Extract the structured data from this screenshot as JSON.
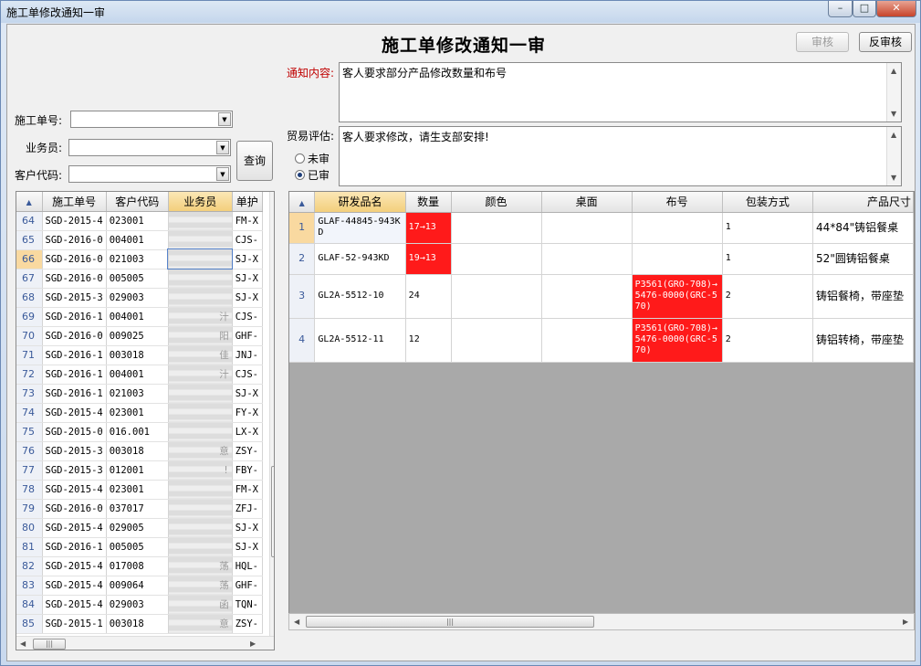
{
  "window": {
    "title": "施工单修改通知一审",
    "minimize": "–",
    "maximize": "□",
    "close": "✕"
  },
  "header": {
    "title": "施工单修改通知一审",
    "approve_label": "审核",
    "unapprove_label": "反审核"
  },
  "filters": {
    "order_no_label": "施工单号:",
    "salesman_label": "业务员:",
    "customer_code_label": "客户代码:",
    "order_no_value": "",
    "salesman_value": "",
    "customer_code_value": "",
    "query_label": "查询"
  },
  "notice": {
    "label": "通知内容:",
    "text": "客人要求部分产品修改数量和布号"
  },
  "trade": {
    "label": "贸易评估:",
    "text": "客人要求修改，请生支部安排!"
  },
  "status": {
    "unreviewed_label": "未审",
    "reviewed_label": "已审",
    "selected": "已审"
  },
  "left_grid": {
    "columns": [
      "施工单号",
      "客户代码",
      "业务员",
      "单护"
    ],
    "selected_row": "66",
    "rows": [
      {
        "n": "64",
        "order": "SGD-2015-4",
        "cust": "023001",
        "sales": "",
        "code": "FM-X"
      },
      {
        "n": "65",
        "order": "SGD-2016-0",
        "cust": "004001",
        "sales": "",
        "code": "CJS-"
      },
      {
        "n": "66",
        "order": "SGD-2016-0",
        "cust": "021003",
        "sales": "",
        "code": "SJ-X"
      },
      {
        "n": "67",
        "order": "SGD-2016-0",
        "cust": "005005",
        "sales": "",
        "code": "SJ-X"
      },
      {
        "n": "68",
        "order": "SGD-2015-3",
        "cust": "029003",
        "sales": "",
        "code": "SJ-X"
      },
      {
        "n": "69",
        "order": "SGD-2016-1",
        "cust": "004001",
        "sales": "汁",
        "code": "CJS-"
      },
      {
        "n": "70",
        "order": "SGD-2016-0",
        "cust": "009025",
        "sales": "阳",
        "code": "GHF-"
      },
      {
        "n": "71",
        "order": "SGD-2016-1",
        "cust": "003018",
        "sales": "佳",
        "code": "JNJ-"
      },
      {
        "n": "72",
        "order": "SGD-2016-1",
        "cust": "004001",
        "sales": "汁",
        "code": "CJS-"
      },
      {
        "n": "73",
        "order": "SGD-2016-1",
        "cust": "021003",
        "sales": "",
        "code": "SJ-X"
      },
      {
        "n": "74",
        "order": "SGD-2015-4",
        "cust": "023001",
        "sales": "",
        "code": "FY-X"
      },
      {
        "n": "75",
        "order": "SGD-2015-0",
        "cust": "016.001",
        "sales": "",
        "code": "LX-X"
      },
      {
        "n": "76",
        "order": "SGD-2015-3",
        "cust": "003018",
        "sales": "意",
        "code": "ZSY-"
      },
      {
        "n": "77",
        "order": "SGD-2015-3",
        "cust": "012001",
        "sales": "!",
        "code": "FBY-"
      },
      {
        "n": "78",
        "order": "SGD-2015-4",
        "cust": "023001",
        "sales": "",
        "code": "FM-X"
      },
      {
        "n": "79",
        "order": "SGD-2016-0",
        "cust": "037017",
        "sales": "",
        "code": "ZFJ-"
      },
      {
        "n": "80",
        "order": "SGD-2015-4",
        "cust": "029005",
        "sales": "",
        "code": "SJ-X"
      },
      {
        "n": "81",
        "order": "SGD-2016-1",
        "cust": "005005",
        "sales": "",
        "code": "SJ-X"
      },
      {
        "n": "82",
        "order": "SGD-2015-4",
        "cust": "017008",
        "sales": "荡",
        "code": "HQL-"
      },
      {
        "n": "83",
        "order": "SGD-2015-4",
        "cust": "009064",
        "sales": "荡",
        "code": "GHF-"
      },
      {
        "n": "84",
        "order": "SGD-2015-4",
        "cust": "029003",
        "sales": "函",
        "code": "TQN-"
      },
      {
        "n": "85",
        "order": "SGD-2015-1",
        "cust": "003018",
        "sales": "意",
        "code": "ZSY-"
      }
    ]
  },
  "right_grid": {
    "columns": [
      "研发品名",
      "数量",
      "颜色",
      "桌面",
      "布号",
      "包装方式",
      "产品尺寸"
    ],
    "selected_row": "1",
    "rows": [
      {
        "n": "1",
        "name": "GLAF-44845-943KD",
        "qty": "17→13",
        "qty_changed": true,
        "color": "",
        "top": "",
        "fabric": "",
        "fabric_changed": false,
        "pack": "1",
        "size": "44*84\"铸铝餐桌"
      },
      {
        "n": "2",
        "name": "GLAF-52-943KD",
        "qty": "19→13",
        "qty_changed": true,
        "color": "",
        "top": "",
        "fabric": "",
        "fabric_changed": false,
        "pack": "1",
        "size": "52\"圆铸铝餐桌"
      },
      {
        "n": "3",
        "name": "GL2A-5512-10",
        "qty": "24",
        "qty_changed": false,
        "color": "",
        "top": "",
        "fabric": "P3561(GRO-708)→5476-0000(GRC-570)",
        "fabric_changed": true,
        "pack": "2",
        "size": "铸铝餐椅，带座垫"
      },
      {
        "n": "4",
        "name": "GL2A-5512-11",
        "qty": "12",
        "qty_changed": false,
        "color": "",
        "top": "",
        "fabric": "P3561(GRO-708)→5476-0000(GRC-570)",
        "fabric_changed": true,
        "pack": "2",
        "size": "铸铝转椅，带座垫"
      }
    ]
  },
  "colors": {
    "changed_cell": "#ff1a1a",
    "notice_label": "#c00000",
    "selected_row_header": "#f9d9a0",
    "empty_area": "#a9a9a9"
  },
  "icons": {
    "scroll_up": "▲",
    "scroll_down": "▼",
    "scroll_left": "◀",
    "scroll_right": "▶",
    "grip": "|||",
    "dropdown": "▼",
    "sort": "▲"
  }
}
